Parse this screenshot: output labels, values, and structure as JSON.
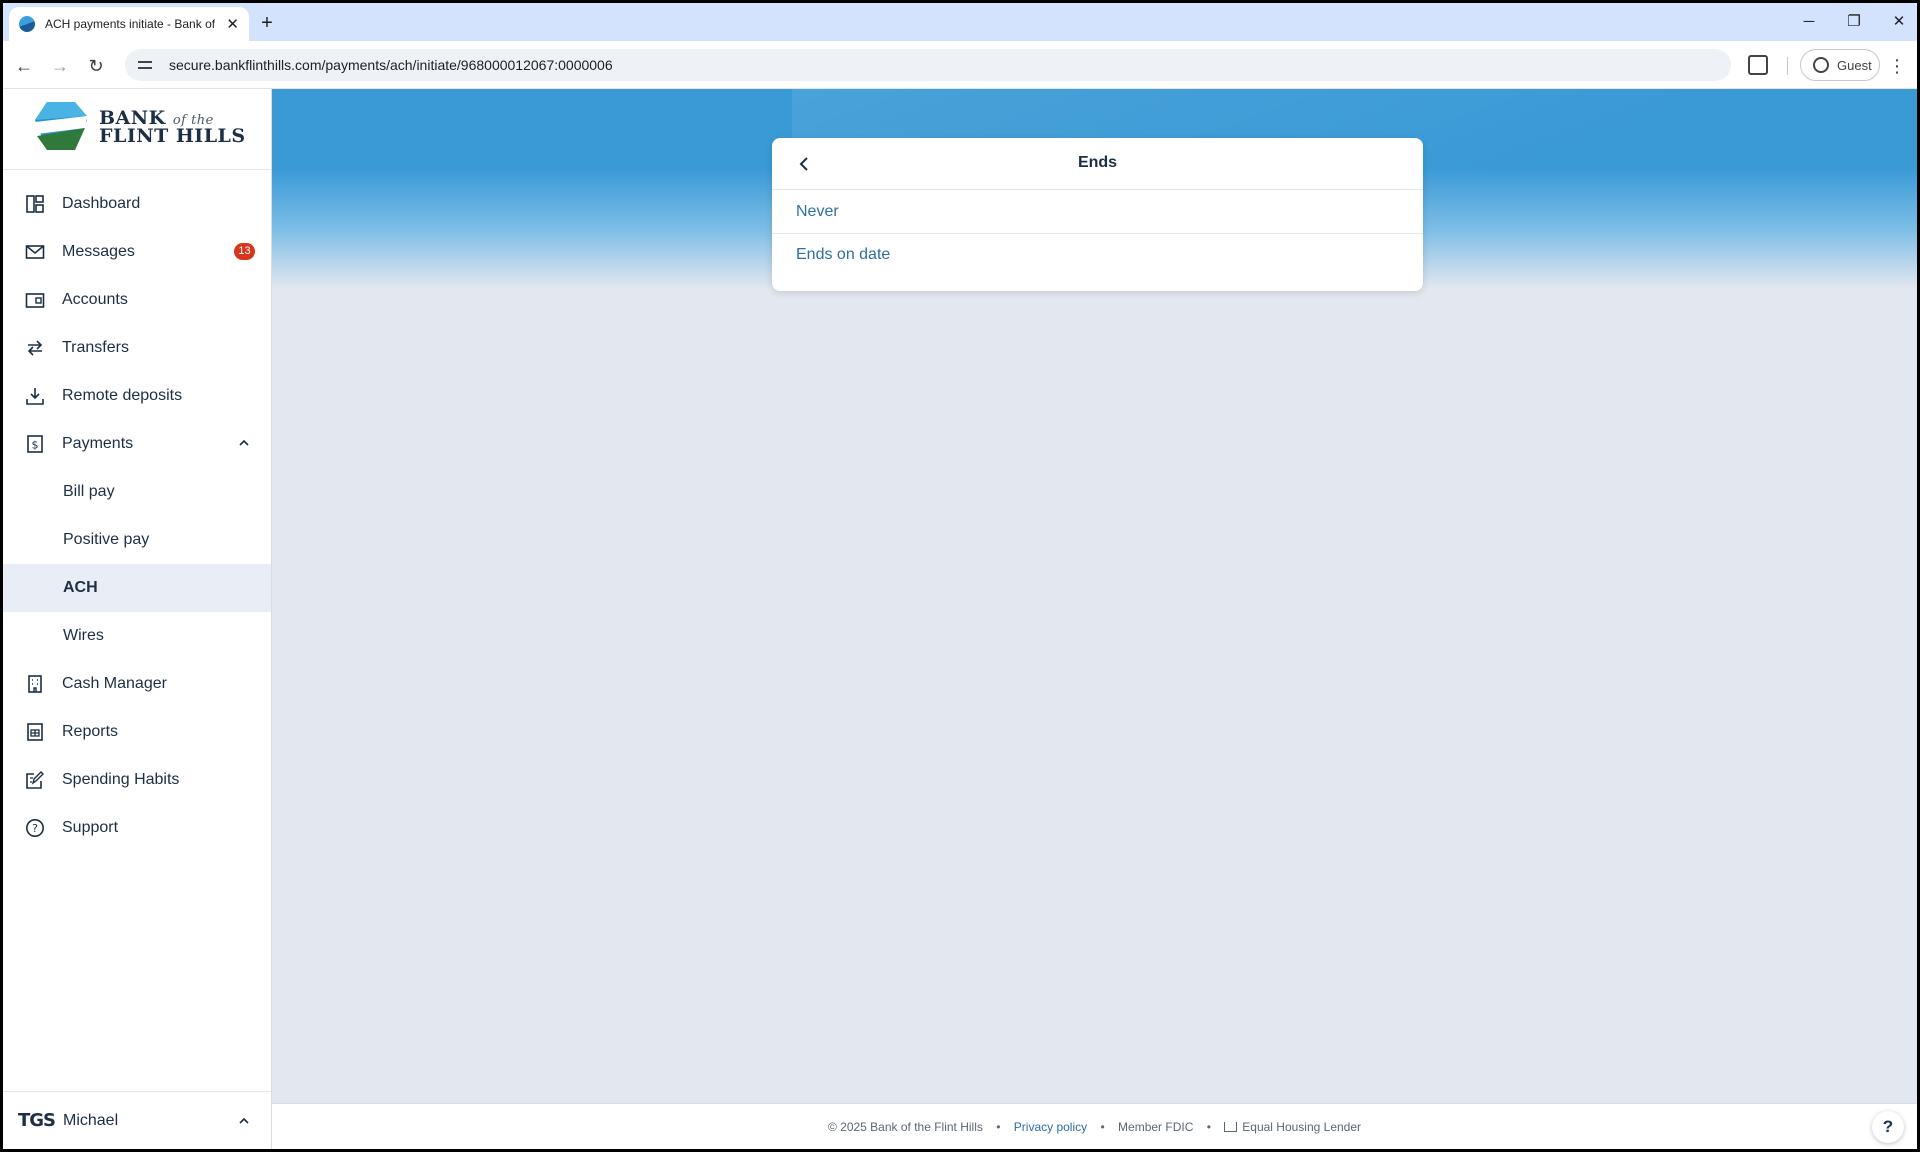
{
  "browser": {
    "tab_title": "ACH payments initiate - Bank of the Flint Hills",
    "url": "secure.bankflinthills.com/payments/ach/initiate/968000012067:0000006",
    "profile_label": "Guest"
  },
  "logo": {
    "line1": "BANK",
    "ofthe": "of the",
    "line2": "FLINT HILLS"
  },
  "nav": {
    "items": [
      {
        "label": "Dashboard",
        "icon": "dashboard-icon"
      },
      {
        "label": "Messages",
        "icon": "mail-icon",
        "badge": "13"
      },
      {
        "label": "Accounts",
        "icon": "wallet-icon"
      },
      {
        "label": "Transfers",
        "icon": "transfer-icon"
      },
      {
        "label": "Remote deposits",
        "icon": "download-icon"
      },
      {
        "label": "Payments",
        "icon": "dollar-icon",
        "expanded": true
      },
      {
        "label": "Bill pay",
        "sub": true
      },
      {
        "label": "Positive pay",
        "sub": true
      },
      {
        "label": "ACH",
        "sub": true,
        "active": true
      },
      {
        "label": "Wires",
        "sub": true
      },
      {
        "label": "Cash Manager",
        "icon": "building-icon"
      },
      {
        "label": "Reports",
        "icon": "report-icon"
      },
      {
        "label": "Spending Habits",
        "icon": "edit-icon"
      },
      {
        "label": "Support",
        "icon": "help-circle-icon"
      }
    ]
  },
  "user": {
    "org_logo": "TGS",
    "name": "Michael"
  },
  "dialog": {
    "title": "Ends",
    "options": [
      "Never",
      "Ends on date"
    ]
  },
  "footer": {
    "copyright": "© 2025 Bank of the Flint Hills",
    "privacy": "Privacy policy",
    "fdic": "Member FDIC",
    "housing": "Equal Housing Lender",
    "help": "?"
  },
  "colors": {
    "brand_navy": "#1c2f45",
    "link_blue": "#2e6ea6",
    "hero_blue": "#3a9ad6",
    "badge_red": "#d6361c",
    "active_bg": "#e9eef6"
  }
}
